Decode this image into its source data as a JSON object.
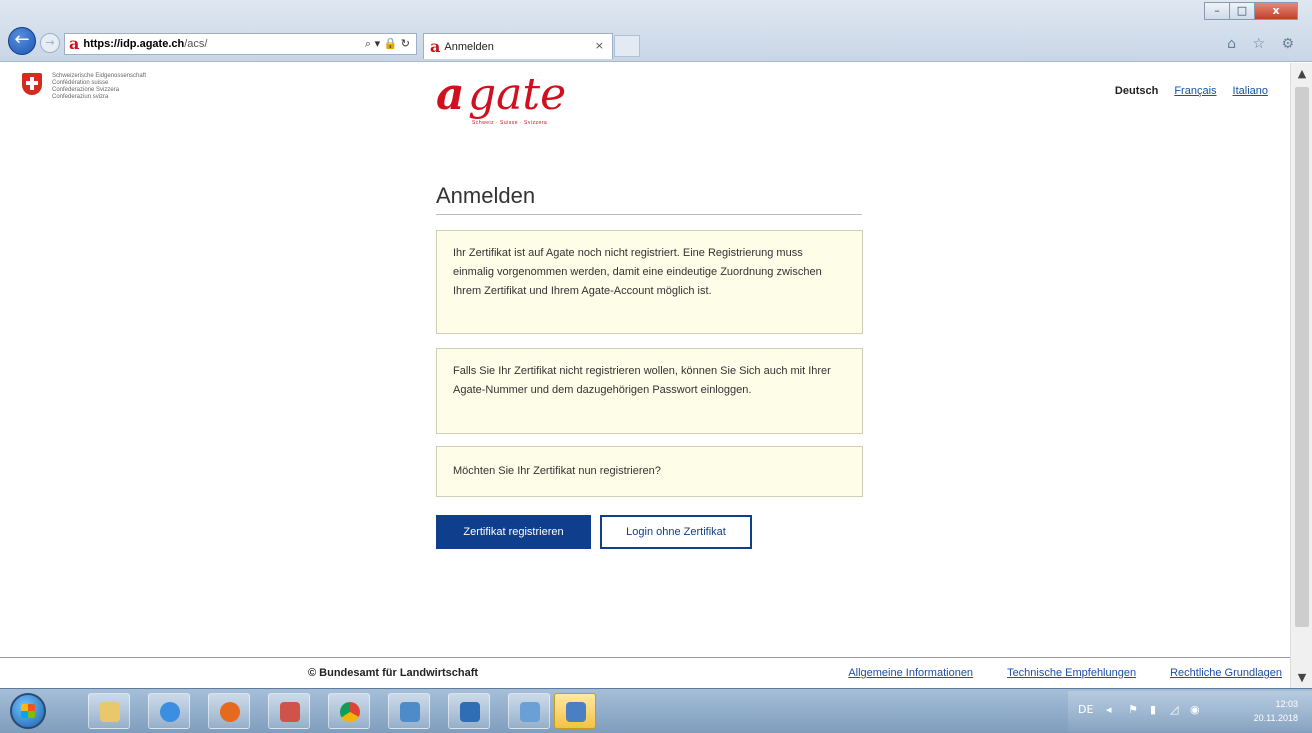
{
  "browser": {
    "url_host": "https://idp.agate.ch",
    "url_path": "/acs/",
    "address_tools": "⌕ ▾ 🔒 ↻",
    "tab_title": "Anmelden",
    "tab_close": "×",
    "tab_logo": "a",
    "window_controls": [
      "–",
      "□",
      "x"
    ],
    "toolbar_icons": "⌂ ☆ ⚙"
  },
  "header": {
    "federal_names": [
      "Schweizerische Eidgenossenschaft",
      "Confédération suisse",
      "Confederazione Svizzera",
      "Confederaziun svizra"
    ],
    "logo_first": "a",
    "logo_rest": "gate",
    "logo_tagline": "Schweiz · Suisse · Svizzera",
    "languages": {
      "active": "Deutsch",
      "links": [
        "Français",
        "Italiano"
      ]
    }
  },
  "main": {
    "title": "Anmelden",
    "box1": "Ihr Zertifikat ist auf Agate noch nicht registriert. Eine Registrierung muss einmalig vorgenommen werden, damit eine eindeutige Zuordnung zwischen Ihrem Zertifikat und Ihrem Agate-Account möglich ist.",
    "box2": "Falls Sie Ihr Zertifikat nicht registrieren wollen, können Sie Sich auch mit Ihrer Agate-Nummer und dem dazugehörigen Passwort einloggen.",
    "box3": "Möchten Sie Ihr Zertifikat nun registrieren?",
    "primary_button": "Zertifikat registrieren",
    "secondary_button": "Login ohne Zertifikat"
  },
  "footer": {
    "copyright": "© Bundesamt für Landwirtschaft",
    "links": [
      "Allgemeine Informationen",
      "Technische Empfehlungen",
      "Rechtliche Grundlagen"
    ]
  },
  "taskbar": {
    "tray_lang": "DE",
    "time": "12:03",
    "date": "20.11.2018"
  },
  "colors": {
    "brand_red": "#d0101e",
    "primary_blue": "#0f3f8c",
    "info_box_bg": "#fdfde8"
  }
}
